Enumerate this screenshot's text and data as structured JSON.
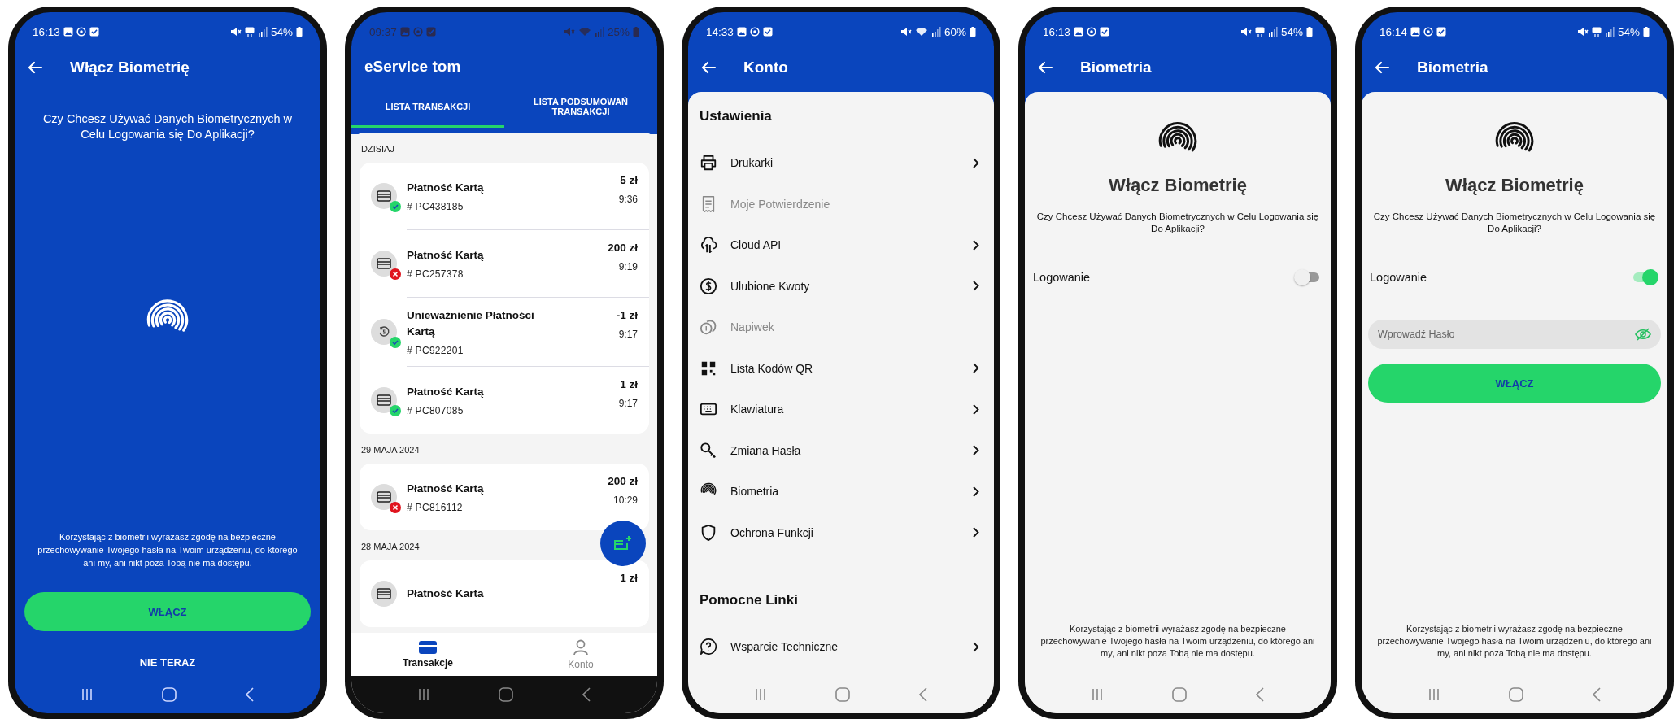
{
  "phones": [
    {
      "kind": "intro",
      "status": {
        "time": "16:13",
        "battery": "54%",
        "wifi": false
      },
      "title": "Włącz Biometrię",
      "question": "Czy Chcesz Używać Danych Biometrycznych w Celu Logowania się Do Aplikacji?",
      "consent": "Korzystając z biometrii wyrażasz zgodę na bezpieczne przechowywanie Twojego hasła na Twoim urządzeniu, do którego ani my, ani nikt poza Tobą nie ma dostępu.",
      "primary_button": "WŁĄCZ",
      "secondary_button": "NIE TERAZ"
    },
    {
      "kind": "transactions",
      "status": {
        "time": "09:37",
        "battery": "25%",
        "wifi": true
      },
      "title": "eService tom",
      "tabs": [
        {
          "label": "LISTA TRANSAKCJI",
          "selected": true
        },
        {
          "label": "LISTA PODSUMOWAŃ TRANSAKCJI",
          "selected": false
        }
      ],
      "groups": [
        {
          "date": "DZISIAJ",
          "items": [
            {
              "kind": "payment",
              "title": "Płatność Kartą",
              "reference": "# PC438185",
              "amount": "5 zł",
              "time": "9:36",
              "failed": false
            },
            {
              "kind": "payment",
              "title": "Płatność Kartą",
              "reference": "# PC257378",
              "amount": "200 zł",
              "time": "9:19",
              "failed": true
            },
            {
              "kind": "void",
              "title": "Unieważnienie Płatności Kartą",
              "reference": "# PC922201",
              "amount": "-1 zł",
              "time": "9:17",
              "failed": false
            },
            {
              "kind": "payment",
              "title": "Płatność Kartą",
              "reference": "# PC807085",
              "amount": "1 zł",
              "time": "9:17",
              "failed": false
            }
          ]
        },
        {
          "date": "29 MAJA 2024",
          "items": [
            {
              "kind": "payment",
              "title": "Płatność Kartą",
              "reference": "# PC816112",
              "amount": "200 zł",
              "time": "10:29",
              "failed": true
            }
          ]
        },
        {
          "date": "28 MAJA 2024",
          "items": [
            {
              "kind": "payment",
              "title": "Płatność Karta",
              "amount": "1 zł"
            }
          ]
        }
      ],
      "bottom_nav": [
        {
          "label": "Transakcje",
          "selected": true
        },
        {
          "label": "Konto",
          "selected": false
        }
      ]
    },
    {
      "kind": "settings",
      "status": {
        "time": "14:33",
        "battery": "60%",
        "wifi": true
      },
      "title": "Konto",
      "sections": [
        {
          "heading": "Ustawienia",
          "items": [
            {
              "label": "Drukarki",
              "disabled": false
            },
            {
              "label": "Moje Potwierdzenie",
              "disabled": true
            },
            {
              "label": "Cloud API",
              "disabled": false
            },
            {
              "label": "Ulubione Kwoty",
              "disabled": false
            },
            {
              "label": "Napiwek",
              "disabled": true
            },
            {
              "label": "Lista Kodów QR",
              "disabled": false
            },
            {
              "label": "Klawiatura",
              "disabled": false
            },
            {
              "label": "Zmiana Hasła",
              "disabled": false
            },
            {
              "label": "Biometria",
              "disabled": false
            },
            {
              "label": "Ochrona Funkcji",
              "disabled": false
            }
          ]
        },
        {
          "heading": "Pomocne Linki",
          "items": [
            {
              "label": "Wsparcie Techniczne",
              "disabled": false
            }
          ]
        }
      ]
    },
    {
      "kind": "biometrics",
      "status": {
        "time": "16:13",
        "battery": "54%",
        "wifi": false
      },
      "title": "Biometria",
      "heading": "Włącz Biometrię",
      "question": "Czy Chcesz Używać Danych Biometrycznych w Celu Logowania się Do Aplikacji?",
      "toggle": {
        "label": "Logowanie",
        "on": false
      },
      "consent": "Korzystając z biometrii wyrażasz zgodę na bezpieczne przechowywanie Twojego hasła na Twoim urządzeniu, do którego ani my, ani nikt poza Tobą nie ma dostępu."
    },
    {
      "kind": "biometrics",
      "status": {
        "time": "16:14",
        "battery": "54%",
        "wifi": false
      },
      "title": "Biometria",
      "heading": "Włącz Biometrię",
      "question": "Czy Chcesz Używać Danych Biometrycznych w Celu Logowania się Do Aplikacji?",
      "toggle": {
        "label": "Logowanie",
        "on": true
      },
      "password_field": {
        "placeholder": "Wprowadź Hasło"
      },
      "button": "WŁĄCZ",
      "consent": "Korzystając z biometrii wyrażasz zgodę na bezpieczne przechowywanie Twojego hasła na Twoim urządzeniu, do którego ani my, ani nikt poza Tobą nie ma dostępu."
    }
  ]
}
